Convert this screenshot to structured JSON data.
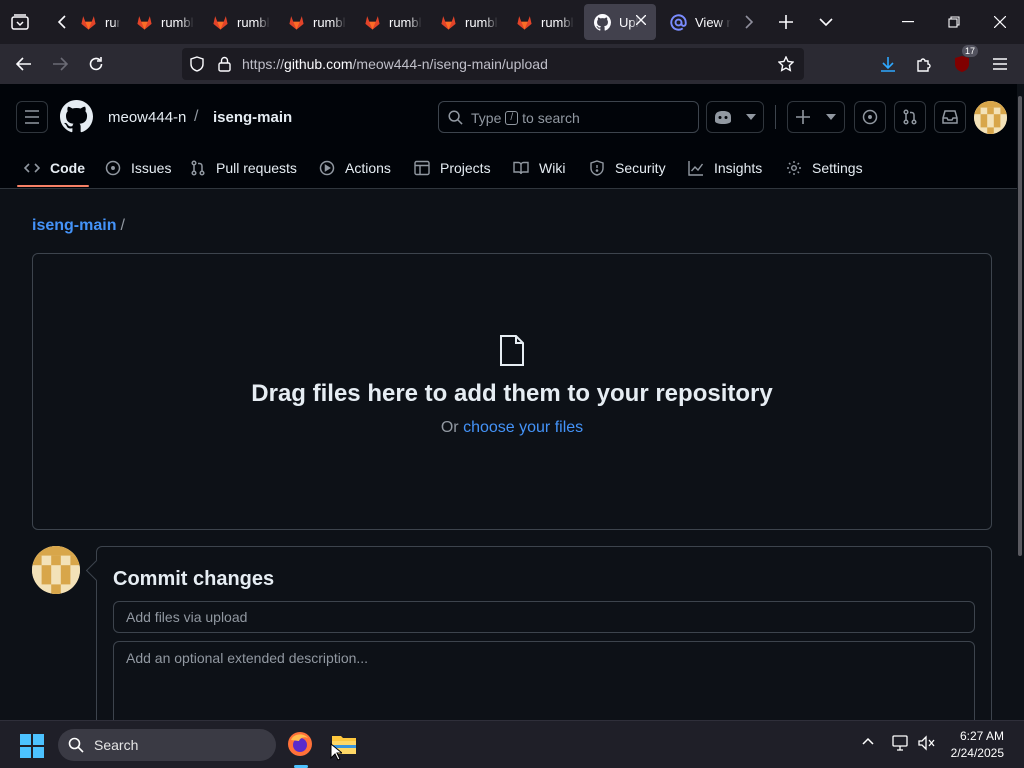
{
  "browser": {
    "tabs": [
      {
        "label": "rumbl",
        "icon": "gitlab-icon"
      },
      {
        "label": "rumbl",
        "icon": "gitlab-icon"
      },
      {
        "label": "rumbl",
        "icon": "gitlab-icon"
      },
      {
        "label": "rumbl",
        "icon": "gitlab-icon"
      },
      {
        "label": "rumbl",
        "icon": "gitlab-icon"
      },
      {
        "label": "rumbl",
        "icon": "gitlab-icon"
      },
      {
        "label": "rumbl",
        "icon": "gitlab-icon"
      },
      {
        "label": "Upl",
        "icon": "github-icon",
        "active": true
      },
      {
        "label": "View r",
        "icon": "at-sign-icon"
      }
    ],
    "url_prefix": "https://",
    "url_host": "github.com",
    "url_path": "/meow444-n/iseng-main/upload",
    "extension_badge": "17"
  },
  "github": {
    "owner": "meow444-n",
    "separator": "/",
    "repo": "iseng-main",
    "search_pre": "Type",
    "search_key": "/",
    "search_post": "to search",
    "tabs": {
      "code": "Code",
      "issues": "Issues",
      "pulls": "Pull requests",
      "actions": "Actions",
      "projects": "Projects",
      "wiki": "Wiki",
      "security": "Security",
      "insights": "Insights",
      "settings": "Settings"
    }
  },
  "upload": {
    "breadcrumb_repo": "iseng-main",
    "breadcrumb_sep": "/",
    "drop_title": "Drag files here to add them to your repository",
    "drop_or": "Or",
    "drop_link": "choose your files",
    "commit_title": "Commit changes",
    "summary_placeholder": "Add files via upload",
    "description_placeholder": "Add an optional extended description..."
  },
  "taskbar": {
    "search_label": "Search",
    "time": "6:27 AM",
    "date": "2/24/2025"
  },
  "colors": {
    "accent_link": "#4493f8",
    "tab_underline": "#f78166",
    "background": "#0d1117"
  }
}
